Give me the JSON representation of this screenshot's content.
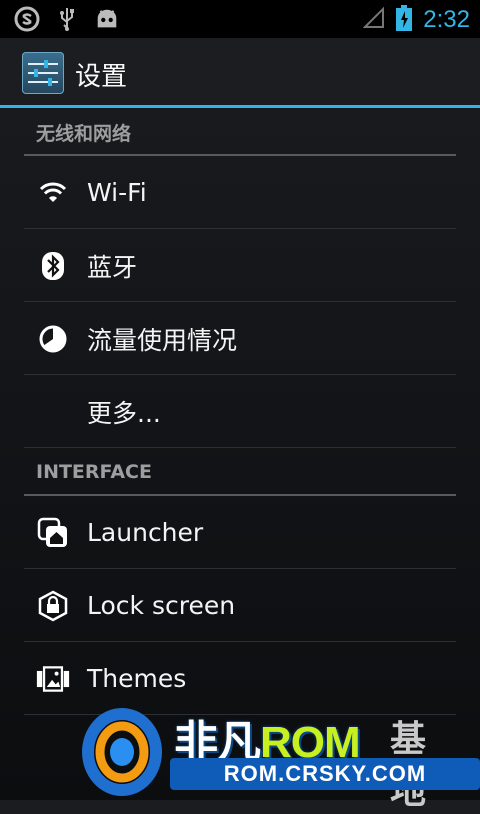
{
  "status_bar": {
    "time": "2:32",
    "icons": [
      "swype-icon",
      "usb-icon",
      "android-debug-icon",
      "signal-icon",
      "battery-charging-icon"
    ]
  },
  "action_bar": {
    "title": "设置",
    "icon": "settings-sliders-icon"
  },
  "sections": [
    {
      "header": "无线和网络",
      "items": [
        {
          "label": "Wi-Fi",
          "icon": "wifi-icon"
        },
        {
          "label": "蓝牙",
          "icon": "bluetooth-icon"
        },
        {
          "label": "流量使用情况",
          "icon": "data-usage-icon"
        },
        {
          "label": "更多...",
          "icon": ""
        }
      ]
    },
    {
      "header": "INTERFACE",
      "items": [
        {
          "label": "Launcher",
          "icon": "launcher-icon"
        },
        {
          "label": "Lock screen",
          "icon": "lock-screen-icon"
        },
        {
          "label": "Themes",
          "icon": "themes-icon"
        }
      ]
    }
  ],
  "watermark": {
    "brand_a": "非凡",
    "brand_b": "ROM",
    "brand_c": "基地",
    "url": "ROM.CRSKY.COM"
  },
  "colors": {
    "accent": "#33b5e5",
    "background": "#131518",
    "section_text": "#9e9e9e"
  }
}
